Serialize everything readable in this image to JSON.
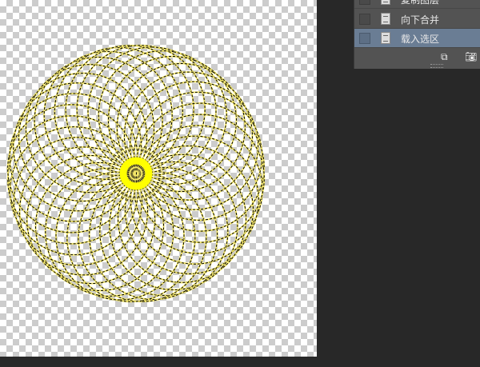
{
  "history_panel": {
    "items": [
      {
        "label": "复制图层",
        "selected": false
      },
      {
        "label": "向下合并",
        "selected": false
      },
      {
        "label": "载入选区",
        "selected": true
      }
    ],
    "buttons": {
      "new_document_icon": "new-document-from-state-icon",
      "snapshot_icon": "camera-icon"
    }
  },
  "canvas": {
    "selection_color": "#000000",
    "stroke_color": "#f5e86a",
    "ring_color": "#ffff00"
  }
}
